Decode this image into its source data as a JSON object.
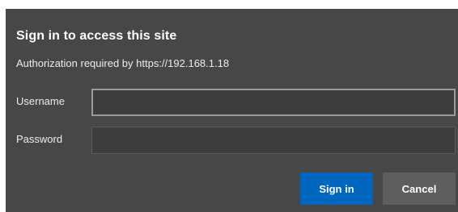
{
  "dialog": {
    "title": "Sign in to access this site",
    "subtitle": "Authorization required by https://192.168.1.18",
    "username": {
      "label": "Username",
      "value": "",
      "placeholder": ""
    },
    "password": {
      "label": "Password",
      "value": "",
      "placeholder": ""
    },
    "buttons": {
      "signin": "Sign in",
      "cancel": "Cancel"
    }
  },
  "colors": {
    "background": "#474747",
    "primary_button": "#0067c0",
    "secondary_button": "#5e5e5e"
  }
}
